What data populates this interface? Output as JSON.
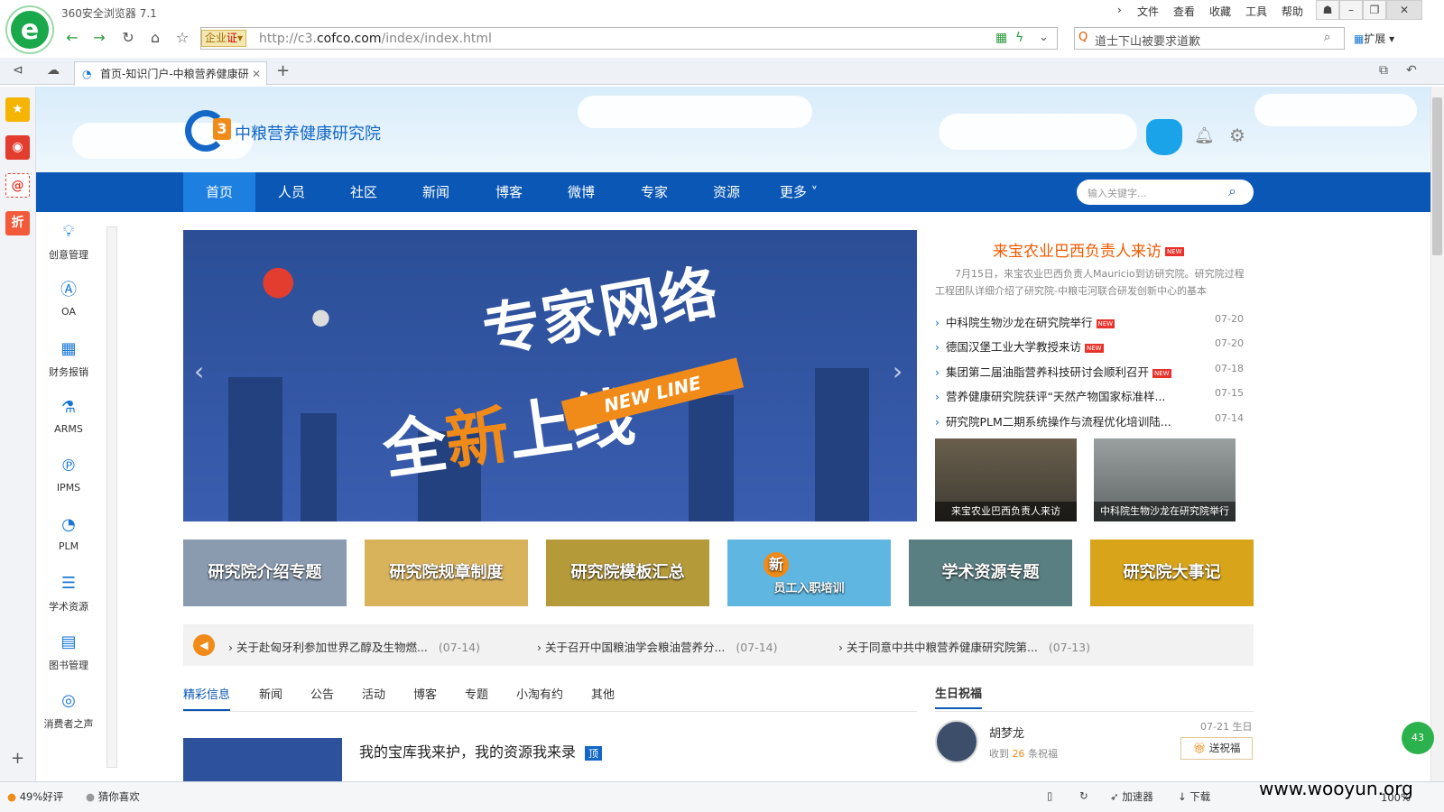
{
  "browser": {
    "app_title": "360安全浏览器 7.1",
    "menu": [
      "文件",
      "查看",
      "收藏",
      "工具",
      "帮助"
    ],
    "enterprise_badge": "企业",
    "enterprise_cert": "证",
    "url_prefix": "http://c3.",
    "url_domain": "cofco.com",
    "url_path": "/index/index.html",
    "search_text": "道士下山被要求道歉",
    "extend_label": "扩展",
    "tab_title": "首页-知识门户-中粮营养健康研",
    "new_tab": "+"
  },
  "header": {
    "brand_name": "中粮营养健康研究院",
    "brand_mark": "3"
  },
  "nav": {
    "items": [
      "首页",
      "人员",
      "社区",
      "新闻",
      "博客",
      "微博",
      "专家",
      "资源",
      "更多"
    ],
    "search_placeholder": "输入关键字..."
  },
  "leftbar": {
    "items": [
      {
        "label": "创意管理",
        "icon": "lightbulb-icon"
      },
      {
        "label": "OA",
        "icon": "oa-icon"
      },
      {
        "label": "财务报销",
        "icon": "calculator-icon"
      },
      {
        "label": "ARMS",
        "icon": "flask-icon"
      },
      {
        "label": "IPMS",
        "icon": "ipms-icon"
      },
      {
        "label": "PLM",
        "icon": "pie-chart-icon"
      },
      {
        "label": "学术资源",
        "icon": "document-icon"
      },
      {
        "label": "图书管理",
        "icon": "book-icon"
      },
      {
        "label": "消费者之声",
        "icon": "globe-icon"
      }
    ]
  },
  "banner": {
    "line1": "专家网络",
    "line2_pre": "全",
    "line2_accent": "新",
    "line2_post": "上线",
    "tag": "NEW LINE"
  },
  "headline": {
    "title": "来宝农业巴西负责人来访",
    "new_tag": "NEW",
    "desc": "7月15日，来宝农业巴西负责人Mauricio到访研究院。研究院过程工程团队详细介绍了研究院-中粮屯河联合研发创新中心的基本"
  },
  "news": [
    {
      "title": "中科院生物沙龙在研究院举行",
      "date": "07-20",
      "new": true
    },
    {
      "title": "德国汉堡工业大学教授来访",
      "date": "07-20",
      "new": true
    },
    {
      "title": "集团第二届油脂营养科技研讨会顺利召开",
      "date": "07-18",
      "new": true
    },
    {
      "title": "营养健康研究院获评“天然产物国家标准样...",
      "date": "07-15",
      "new": false
    },
    {
      "title": "研究院PLM二期系统操作与流程优化培训陆...",
      "date": "07-14",
      "new": false
    }
  ],
  "thumbs": [
    {
      "caption": "来宝农业巴西负责人来访"
    },
    {
      "caption": "中科院生物沙龙在研究院举行"
    }
  ],
  "tiles": [
    {
      "label": "研究院介绍专题",
      "bg": "#8a9bb0"
    },
    {
      "label": "研究院规章制度",
      "bg": "#d9b25c"
    },
    {
      "label": "研究院模板汇总",
      "bg": "#b59a3a"
    },
    {
      "label": "员工入职培训",
      "bg": "#5fb6e0",
      "badge": "新"
    },
    {
      "label": "学术资源专题",
      "bg": "#5a7f82"
    },
    {
      "label": "研究院大事记",
      "bg": "#d8a51a"
    }
  ],
  "notices": [
    {
      "text": "关于赴匈牙利参加世界乙醇及生物燃...",
      "date": "(07-14)"
    },
    {
      "text": "关于召开中国粮油学会粮油营养分...",
      "date": "(07-14)"
    },
    {
      "text": "关于同意中共中粮营养健康研究院第...",
      "date": "(07-13)"
    }
  ],
  "content_tabs": [
    "精彩信息",
    "新闻",
    "公告",
    "活动",
    "博客",
    "专题",
    "小淘有约",
    "其他"
  ],
  "post": {
    "title": "我的宝库我来护，我的资源我来录",
    "badge": "顶"
  },
  "birthday": {
    "section_title": "生日祝福",
    "name": "胡梦龙",
    "sub_pre": "收到",
    "count": "26",
    "sub_post": "条祝福",
    "date": "07-21 生日",
    "button": "送祝福"
  },
  "statusbar": {
    "rating": "49%好评",
    "guess": "猜你喜欢",
    "accelerator": "加速器",
    "download": "下载",
    "zoom": "100%"
  },
  "watermark": "www.wooyun.org",
  "colors": {
    "nav_bg": "#0b57b5",
    "nav_active": "#1d7fe0",
    "accent": "#f08b1a",
    "headline": "#f05a00"
  }
}
